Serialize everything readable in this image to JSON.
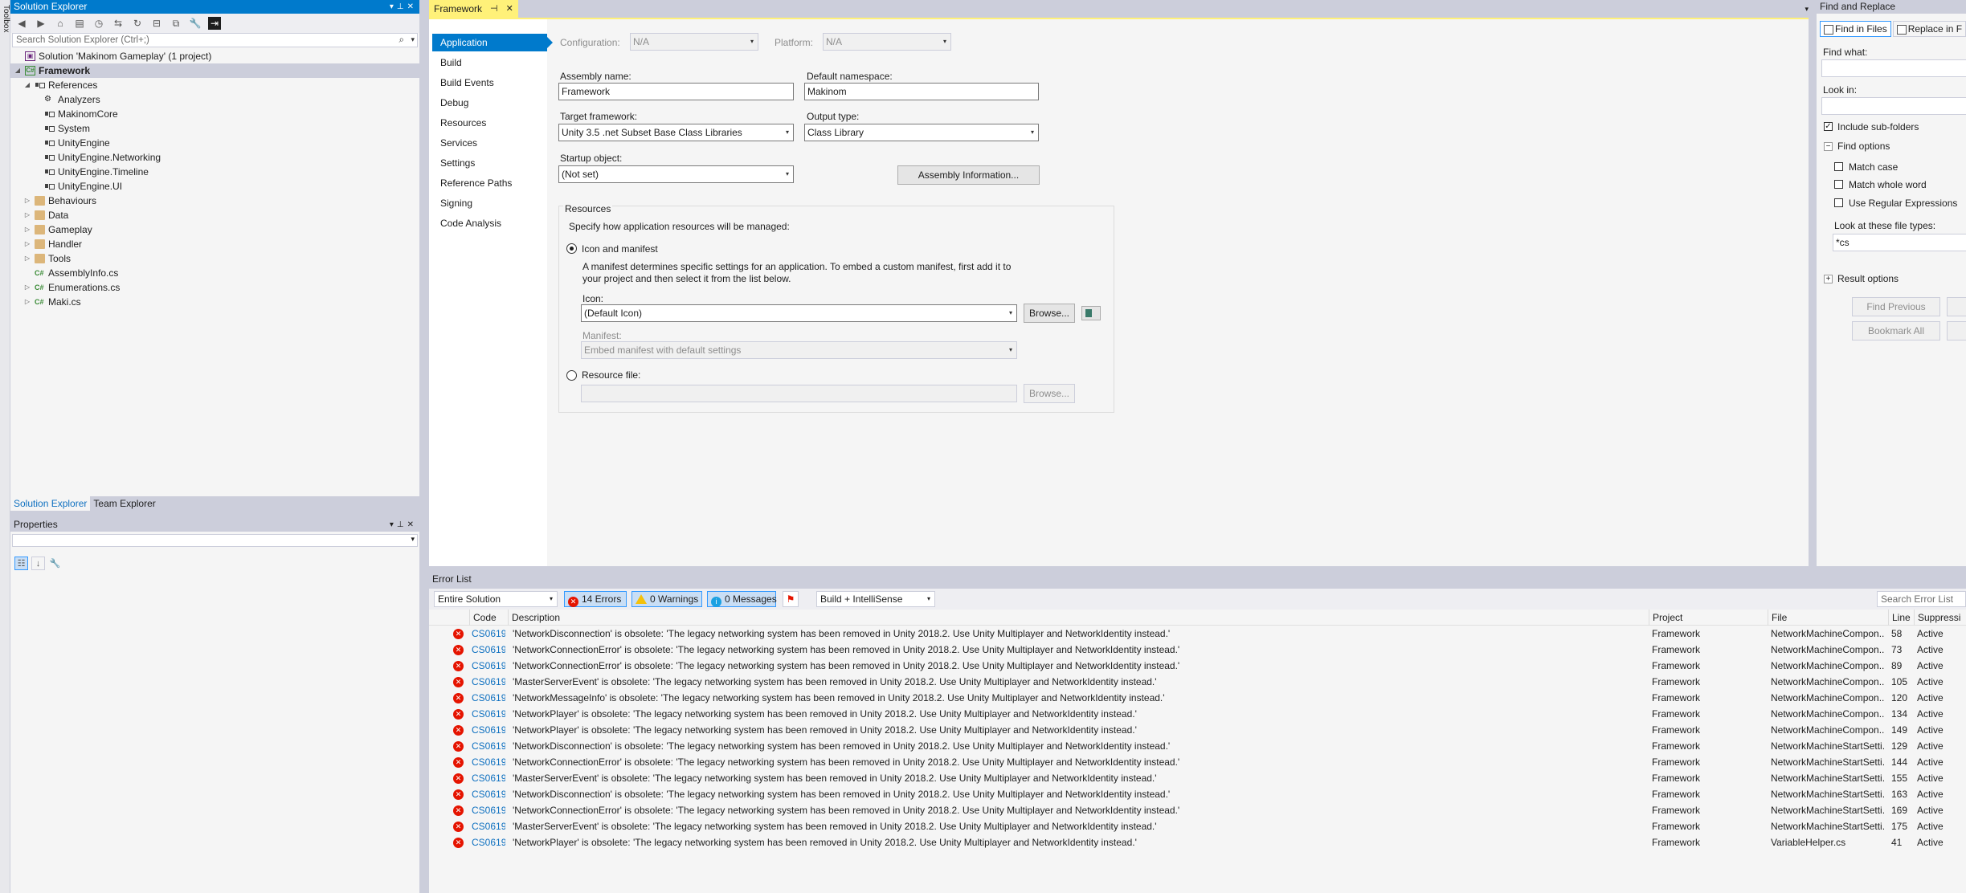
{
  "toolbox": {
    "label": "Toolbox"
  },
  "solution_explorer": {
    "title": "Solution Explorer",
    "search_placeholder": "Search Solution Explorer (Ctrl+;)",
    "tree": [
      {
        "label": "Solution 'Makinom Gameplay' (1 project)",
        "icon": "solution-icon",
        "level": 0,
        "expander": "",
        "selected": false
      },
      {
        "label": "Framework",
        "icon": "project-icon",
        "level": 0,
        "expander": "expanded",
        "selected": true,
        "bold": true
      },
      {
        "label": "References",
        "icon": "references-icon",
        "level": 1,
        "expander": "expanded",
        "selected": false
      },
      {
        "label": "Analyzers",
        "icon": "analyzer-icon",
        "level": 2,
        "expander": "",
        "selected": false
      },
      {
        "label": "MakinomCore",
        "icon": "reference-icon",
        "level": 2,
        "expander": "",
        "selected": false
      },
      {
        "label": "System",
        "icon": "reference-icon",
        "level": 2,
        "expander": "",
        "selected": false
      },
      {
        "label": "UnityEngine",
        "icon": "reference-icon",
        "level": 2,
        "expander": "",
        "selected": false
      },
      {
        "label": "UnityEngine.Networking",
        "icon": "reference-icon",
        "level": 2,
        "expander": "",
        "selected": false
      },
      {
        "label": "UnityEngine.Timeline",
        "icon": "reference-icon",
        "level": 2,
        "expander": "",
        "selected": false
      },
      {
        "label": "UnityEngine.UI",
        "icon": "reference-icon",
        "level": 2,
        "expander": "",
        "selected": false
      },
      {
        "label": "Behaviours",
        "icon": "folder-icon",
        "level": 1,
        "expander": "collapsed",
        "selected": false
      },
      {
        "label": "Data",
        "icon": "folder-icon",
        "level": 1,
        "expander": "collapsed",
        "selected": false
      },
      {
        "label": "Gameplay",
        "icon": "folder-icon",
        "level": 1,
        "expander": "collapsed",
        "selected": false
      },
      {
        "label": "Handler",
        "icon": "folder-icon",
        "level": 1,
        "expander": "collapsed",
        "selected": false
      },
      {
        "label": "Tools",
        "icon": "folder-icon",
        "level": 1,
        "expander": "collapsed",
        "selected": false
      },
      {
        "label": "AssemblyInfo.cs",
        "icon": "csharp-file-icon",
        "level": 1,
        "expander": "",
        "selected": false
      },
      {
        "label": "Enumerations.cs",
        "icon": "csharp-file-icon",
        "level": 1,
        "expander": "collapsed",
        "selected": false
      },
      {
        "label": "Maki.cs",
        "icon": "csharp-file-icon",
        "level": 1,
        "expander": "collapsed",
        "selected": false
      }
    ],
    "tabs": [
      "Solution Explorer",
      "Team Explorer"
    ]
  },
  "properties": {
    "title": "Properties"
  },
  "document": {
    "tab_title": "Framework",
    "nav": [
      "Application",
      "Build",
      "Build Events",
      "Debug",
      "Resources",
      "Services",
      "Settings",
      "Reference Paths",
      "Signing",
      "Code Analysis"
    ],
    "configuration_label": "Configuration:",
    "configuration_value": "N/A",
    "platform_label": "Platform:",
    "platform_value": "N/A",
    "assembly_name_label": "Assembly name:",
    "assembly_name_value": "Framework",
    "default_namespace_label": "Default namespace:",
    "default_namespace_value": "Makinom",
    "target_framework_label": "Target framework:",
    "target_framework_value": "Unity 3.5 .net Subset Base Class Libraries",
    "output_type_label": "Output type:",
    "output_type_value": "Class Library",
    "startup_object_label": "Startup object:",
    "startup_object_value": "(Not set)",
    "assembly_info_button": "Assembly Information...",
    "resources_group": "Resources",
    "resources_desc": "Specify how application resources will be managed:",
    "icon_manifest_radio": "Icon and manifest",
    "manifest_desc_1": "A manifest determines specific settings for an application. To embed a custom manifest, first add it to",
    "manifest_desc_2": "your project and then select it from the list below.",
    "icon_label": "Icon:",
    "icon_value": "(Default Icon)",
    "browse_label": "Browse...",
    "manifest_label": "Manifest:",
    "manifest_value": "Embed manifest with default settings",
    "resource_file_radio": "Resource file:",
    "browse2_label": "Browse..."
  },
  "find_replace": {
    "title": "Find and Replace",
    "tab_find": "Find in Files",
    "tab_replace": "Replace in F",
    "find_what_label": "Find what:",
    "look_in_label": "Look in:",
    "include_subfolders": "Include sub-folders",
    "find_options": "Find options",
    "match_case": "Match case",
    "match_whole_word": "Match whole word",
    "use_regex": "Use Regular Expressions",
    "file_types_label": "Look at these file types:",
    "file_types_value": "*cs",
    "result_options": "Result options",
    "find_previous": "Find Previous",
    "bookmark_all": "Bookmark All"
  },
  "error_list": {
    "title": "Error List",
    "scope": "Entire Solution",
    "errors_btn": "14 Errors",
    "warnings_btn": "0 Warnings",
    "messages_btn": "0 Messages",
    "build_filter": "Build + IntelliSense",
    "search_placeholder": "Search Error List",
    "columns": [
      "Code",
      "Description",
      "Project",
      "File",
      "Line",
      "Suppressi"
    ],
    "rows": [
      {
        "code": "CS0619",
        "desc": "'NetworkDisconnection' is obsolete: 'The legacy networking system has been removed in Unity 2018.2. Use Unity Multiplayer and NetworkIdentity instead.'",
        "project": "Framework",
        "file": "NetworkMachineCompon...",
        "line": "58",
        "supp": "Active"
      },
      {
        "code": "CS0619",
        "desc": "'NetworkConnectionError' is obsolete: 'The legacy networking system has been removed in Unity 2018.2. Use Unity Multiplayer and NetworkIdentity instead.'",
        "project": "Framework",
        "file": "NetworkMachineCompon...",
        "line": "73",
        "supp": "Active"
      },
      {
        "code": "CS0619",
        "desc": "'NetworkConnectionError' is obsolete: 'The legacy networking system has been removed in Unity 2018.2. Use Unity Multiplayer and NetworkIdentity instead.'",
        "project": "Framework",
        "file": "NetworkMachineCompon...",
        "line": "89",
        "supp": "Active"
      },
      {
        "code": "CS0619",
        "desc": "'MasterServerEvent' is obsolete: 'The legacy networking system has been removed in Unity 2018.2. Use Unity Multiplayer and NetworkIdentity instead.'",
        "project": "Framework",
        "file": "NetworkMachineCompon...",
        "line": "105",
        "supp": "Active"
      },
      {
        "code": "CS0619",
        "desc": "'NetworkMessageInfo' is obsolete: 'The legacy networking system has been removed in Unity 2018.2. Use Unity Multiplayer and NetworkIdentity instead.'",
        "project": "Framework",
        "file": "NetworkMachineCompon...",
        "line": "120",
        "supp": "Active"
      },
      {
        "code": "CS0619",
        "desc": "'NetworkPlayer' is obsolete: 'The legacy networking system has been removed in Unity 2018.2. Use Unity Multiplayer and NetworkIdentity instead.'",
        "project": "Framework",
        "file": "NetworkMachineCompon...",
        "line": "134",
        "supp": "Active"
      },
      {
        "code": "CS0619",
        "desc": "'NetworkPlayer' is obsolete: 'The legacy networking system has been removed in Unity 2018.2. Use Unity Multiplayer and NetworkIdentity instead.'",
        "project": "Framework",
        "file": "NetworkMachineCompon...",
        "line": "149",
        "supp": "Active"
      },
      {
        "code": "CS0619",
        "desc": "'NetworkDisconnection' is obsolete: 'The legacy networking system has been removed in Unity 2018.2. Use Unity Multiplayer and NetworkIdentity instead.'",
        "project": "Framework",
        "file": "NetworkMachineStartSetti...",
        "line": "129",
        "supp": "Active"
      },
      {
        "code": "CS0619",
        "desc": "'NetworkConnectionError' is obsolete: 'The legacy networking system has been removed in Unity 2018.2. Use Unity Multiplayer and NetworkIdentity instead.'",
        "project": "Framework",
        "file": "NetworkMachineStartSetti...",
        "line": "144",
        "supp": "Active"
      },
      {
        "code": "CS0619",
        "desc": "'MasterServerEvent' is obsolete: 'The legacy networking system has been removed in Unity 2018.2. Use Unity Multiplayer and NetworkIdentity instead.'",
        "project": "Framework",
        "file": "NetworkMachineStartSetti...",
        "line": "155",
        "supp": "Active"
      },
      {
        "code": "CS0619",
        "desc": "'NetworkDisconnection' is obsolete: 'The legacy networking system has been removed in Unity 2018.2. Use Unity Multiplayer and NetworkIdentity instead.'",
        "project": "Framework",
        "file": "NetworkMachineStartSetti...",
        "line": "163",
        "supp": "Active"
      },
      {
        "code": "CS0619",
        "desc": "'NetworkConnectionError' is obsolete: 'The legacy networking system has been removed in Unity 2018.2. Use Unity Multiplayer and NetworkIdentity instead.'",
        "project": "Framework",
        "file": "NetworkMachineStartSetti...",
        "line": "169",
        "supp": "Active"
      },
      {
        "code": "CS0619",
        "desc": "'MasterServerEvent' is obsolete: 'The legacy networking system has been removed in Unity 2018.2. Use Unity Multiplayer and NetworkIdentity instead.'",
        "project": "Framework",
        "file": "NetworkMachineStartSetti...",
        "line": "175",
        "supp": "Active"
      },
      {
        "code": "CS0619",
        "desc": "'NetworkPlayer' is obsolete: 'The legacy networking system has been removed in Unity 2018.2. Use Unity Multiplayer and NetworkIdentity instead.'",
        "project": "Framework",
        "file": "VariableHelper.cs",
        "line": "41",
        "supp": "Active"
      }
    ]
  },
  "colors": {
    "accent": "#007acc",
    "document_tab": "#fff179",
    "error": "#e51400",
    "code_link": "#0e70c0"
  }
}
